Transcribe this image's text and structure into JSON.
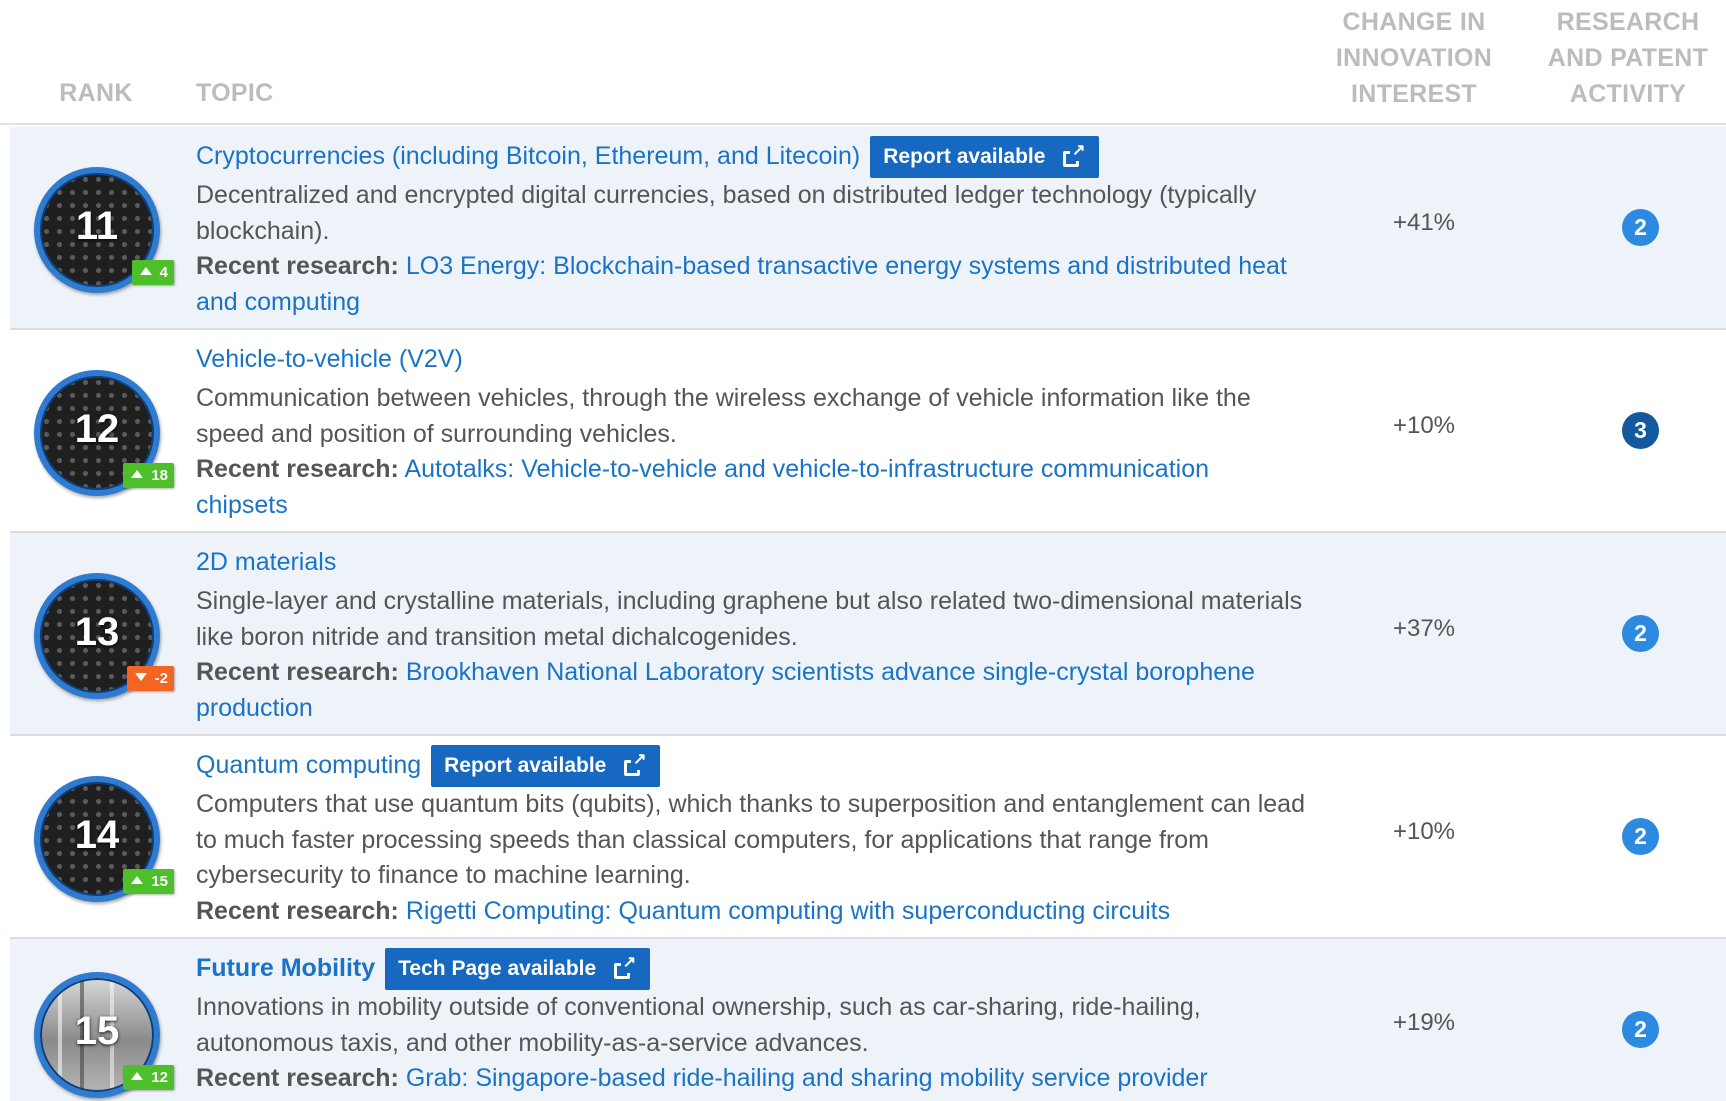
{
  "headers": {
    "rank": "RANK",
    "topic": "TOPIC",
    "change_l1": "CHANGE IN",
    "change_l2": "INNOVATION",
    "change_l3": "INTEREST",
    "research_l1": "RESEARCH",
    "research_l2": "AND PATENT",
    "research_l3": "ACTIVITY"
  },
  "recent_label": "Recent research:",
  "rows": [
    {
      "rank": "11",
      "delta": "4",
      "delta_dir": "up",
      "title": "Cryptocurrencies (including Bitcoin, Ethereum, and Litecoin)",
      "badge": "Report available",
      "description": "Decentralized and encrypted digital currencies, based on distributed ledger technology (typically blockchain).",
      "recent": "LO3 Energy: Blockchain-based transactive energy systems and distributed heat and computing",
      "change": "+41%",
      "activity": "2"
    },
    {
      "rank": "12",
      "delta": "18",
      "delta_dir": "up",
      "title": "Vehicle-to-vehicle (V2V)",
      "badge": "",
      "description": "Communication between vehicles, through the wireless exchange of vehicle information like the speed and position of surrounding vehicles.",
      "recent": "Autotalks: Vehicle-to-vehicle and vehicle-to-infrastructure communication chipsets",
      "change": "+10%",
      "activity": "3"
    },
    {
      "rank": "13",
      "delta": "-2",
      "delta_dir": "down",
      "title": "2D materials",
      "badge": "",
      "description": "Single-layer and crystalline materials, including graphene but also related two-dimensional materials like boron nitride and transition metal dichalcogenides.",
      "recent": "Brookhaven National Laboratory scientists advance single-crystal borophene production",
      "change": "+37%",
      "activity": "2"
    },
    {
      "rank": "14",
      "delta": "15",
      "delta_dir": "up",
      "title": "Quantum computing",
      "badge": "Report available",
      "description": "Computers that use quantum bits (qubits), which thanks to superposition and entanglement can lead to much faster processing speeds than classical computers, for applications that range from cybersecurity to finance to machine learning.",
      "recent": "Rigetti Computing: Quantum computing with superconducting circuits",
      "change": "+10%",
      "activity": "2"
    },
    {
      "rank": "15",
      "delta": "12",
      "delta_dir": "up",
      "title": "Future Mobility",
      "badge": "Tech Page available",
      "description": "Innovations in mobility outside of conventional ownership, such as car-sharing, ride-hailing, autonomous taxis, and other mobility-as-a-service advances.",
      "recent": "Grab: Singapore-based ride-hailing and sharing mobility service provider",
      "change": "+19%",
      "activity": "2"
    }
  ],
  "colors": {
    "link": "#1a73c6",
    "badge": "#1668c1",
    "rank_ring": "#2f7bd0",
    "delta_up": "#4cbf2a",
    "delta_down": "#f26522",
    "activity": "#2c8ae0",
    "activity_high": "#14599e"
  }
}
